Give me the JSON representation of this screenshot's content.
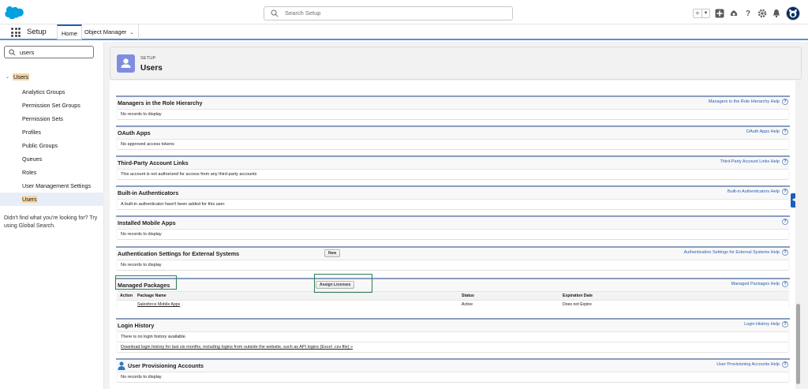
{
  "header": {
    "search_placeholder": "Search Setup",
    "icons": [
      "favorites-star-icon",
      "favorites-dropdown-icon",
      "add-icon",
      "trailhead-icon",
      "help-icon",
      "setup-gear-icon",
      "notifications-bell-icon",
      "user-avatar"
    ]
  },
  "context_bar": {
    "app_name": "Setup",
    "tabs": [
      {
        "label": "Home",
        "active": true
      },
      {
        "label": "Object Manager",
        "active": false
      }
    ]
  },
  "sidebar": {
    "quick_find_value": "users",
    "root_label": "Users",
    "items": [
      {
        "label": "Analytics Groups",
        "active": false
      },
      {
        "label": "Permission Set Groups",
        "active": false
      },
      {
        "label": "Permission Sets",
        "active": false
      },
      {
        "label": "Profiles",
        "active": false
      },
      {
        "label": "Public Groups",
        "active": false
      },
      {
        "label": "Queues",
        "active": false
      },
      {
        "label": "Roles",
        "active": false
      },
      {
        "label": "User Management Settings",
        "active": false
      },
      {
        "label": "Users",
        "active": true
      }
    ],
    "help_text": "Didn't find what you're looking for? Try using Global Search."
  },
  "page_header": {
    "kicker": "SETUP",
    "title": "Users"
  },
  "related_lists": {
    "managers": {
      "title": "Managers in the Role Hierarchy",
      "help": "Managers in the Role Hierarchy Help",
      "body": "No records to display"
    },
    "oauth": {
      "title": "OAuth Apps",
      "help": "OAuth Apps Help",
      "body": "No approved access tokens"
    },
    "third_party": {
      "title": "Third-Party Account Links",
      "help": "Third-Party Account Links Help",
      "body": "This account is not authorized for access from any third-party accounts"
    },
    "authenticators": {
      "title": "Built-in Authenticators",
      "help": "Built-in Authenticators Help",
      "body": "A built-in authenticator hasn't been added for this user."
    },
    "mobile_apps": {
      "title": "Installed Mobile Apps",
      "help": "",
      "body": "No records to display"
    },
    "auth_settings": {
      "title": "Authentication Settings for External Systems",
      "button": "New",
      "help": "Authentication Settings for External Systems Help",
      "body": "No records to display"
    },
    "managed_packages": {
      "title": "Managed Packages",
      "button": "Assign Licenses",
      "help": "Managed Packages Help",
      "columns": {
        "action": "Action",
        "package_name": "Package Name",
        "status": "Status",
        "expiration": "Expiration Date"
      },
      "rows": [
        {
          "package_name": "Salesforce Mobile Apps",
          "status": "Active",
          "expiration": "Does not Expire"
        }
      ]
    },
    "login_history": {
      "title": "Login History",
      "help": "Login History Help",
      "body": "There is no login history available.",
      "link": "Download login history for last six months, including logins from outside the website, such as API logins (Excel .csv file) »"
    },
    "provisioning": {
      "title": "User Provisioning Accounts",
      "help": "User Provisioning Accounts Help",
      "body": "No records to display"
    },
    "help_glyph": "?"
  },
  "colors": {
    "brand_blue": "#1b5fbd",
    "highlight_green": "#2e7d52",
    "sidebar_match": "#f5d7a8",
    "section_border": "#8a9ebe"
  }
}
